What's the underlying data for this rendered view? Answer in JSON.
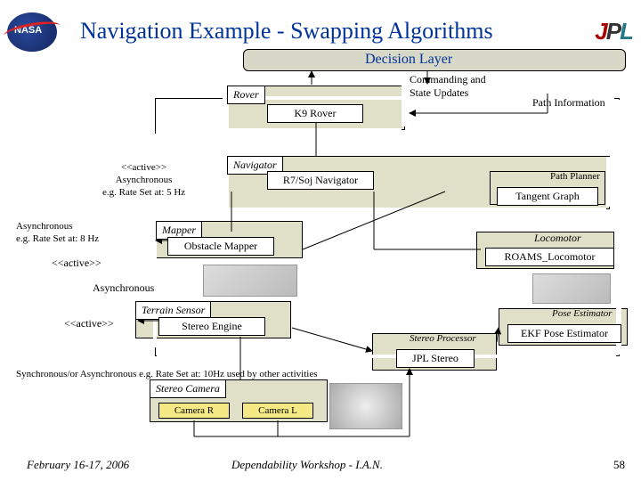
{
  "title": "Navigation Example - Swapping Algorithms",
  "logoLeft": "NASA",
  "decision": "Decision Layer",
  "rover": {
    "outer": "Rover",
    "inner": "K9 Rover"
  },
  "cmdLabel": "Commanding and\nState Updates",
  "pathInfo": "Path Information",
  "nav": {
    "outer": "Navigator",
    "inner": "R7/Soj Navigator"
  },
  "navNote": {
    "stereo": "<<active>>",
    "l2": "Asynchronous",
    "l3": "e.g. Rate Set at: 5 Hz"
  },
  "pathPlanner": {
    "outer": "Path Planner",
    "inner": "Tangent Graph"
  },
  "map": {
    "outer": "Mapper",
    "inner": "Obstacle Mapper"
  },
  "mapNote": {
    "l1": "Asynchronous",
    "l2": "e.g. Rate Set at: 8 Hz",
    "l3": "<<active>>"
  },
  "loc": {
    "outer": "Locomotor",
    "inner": "ROAMS_Locomotor"
  },
  "terrain": {
    "outer": "Terrain Sensor",
    "inner": "Stereo Engine"
  },
  "terrNote": {
    "l1": "Asynchronous",
    "l2": "<<active>>"
  },
  "pose": {
    "outer": "Pose Estimator",
    "inner": "EKF Pose Estimator"
  },
  "sp": {
    "outer": "Stereo Processor",
    "inner": "JPL Stereo"
  },
  "cam": {
    "outer": "Stereo Camera",
    "l": "Camera R",
    "r": "Camera L"
  },
  "camNote": "Synchronous/or\nAsynchronous\ne.g. Rate Set at: 10Hz\nused by other activities",
  "footer": {
    "date": "February 16-17, 2006",
    "mid": "Dependability Workshop - I.A.N.",
    "pg": "58"
  }
}
